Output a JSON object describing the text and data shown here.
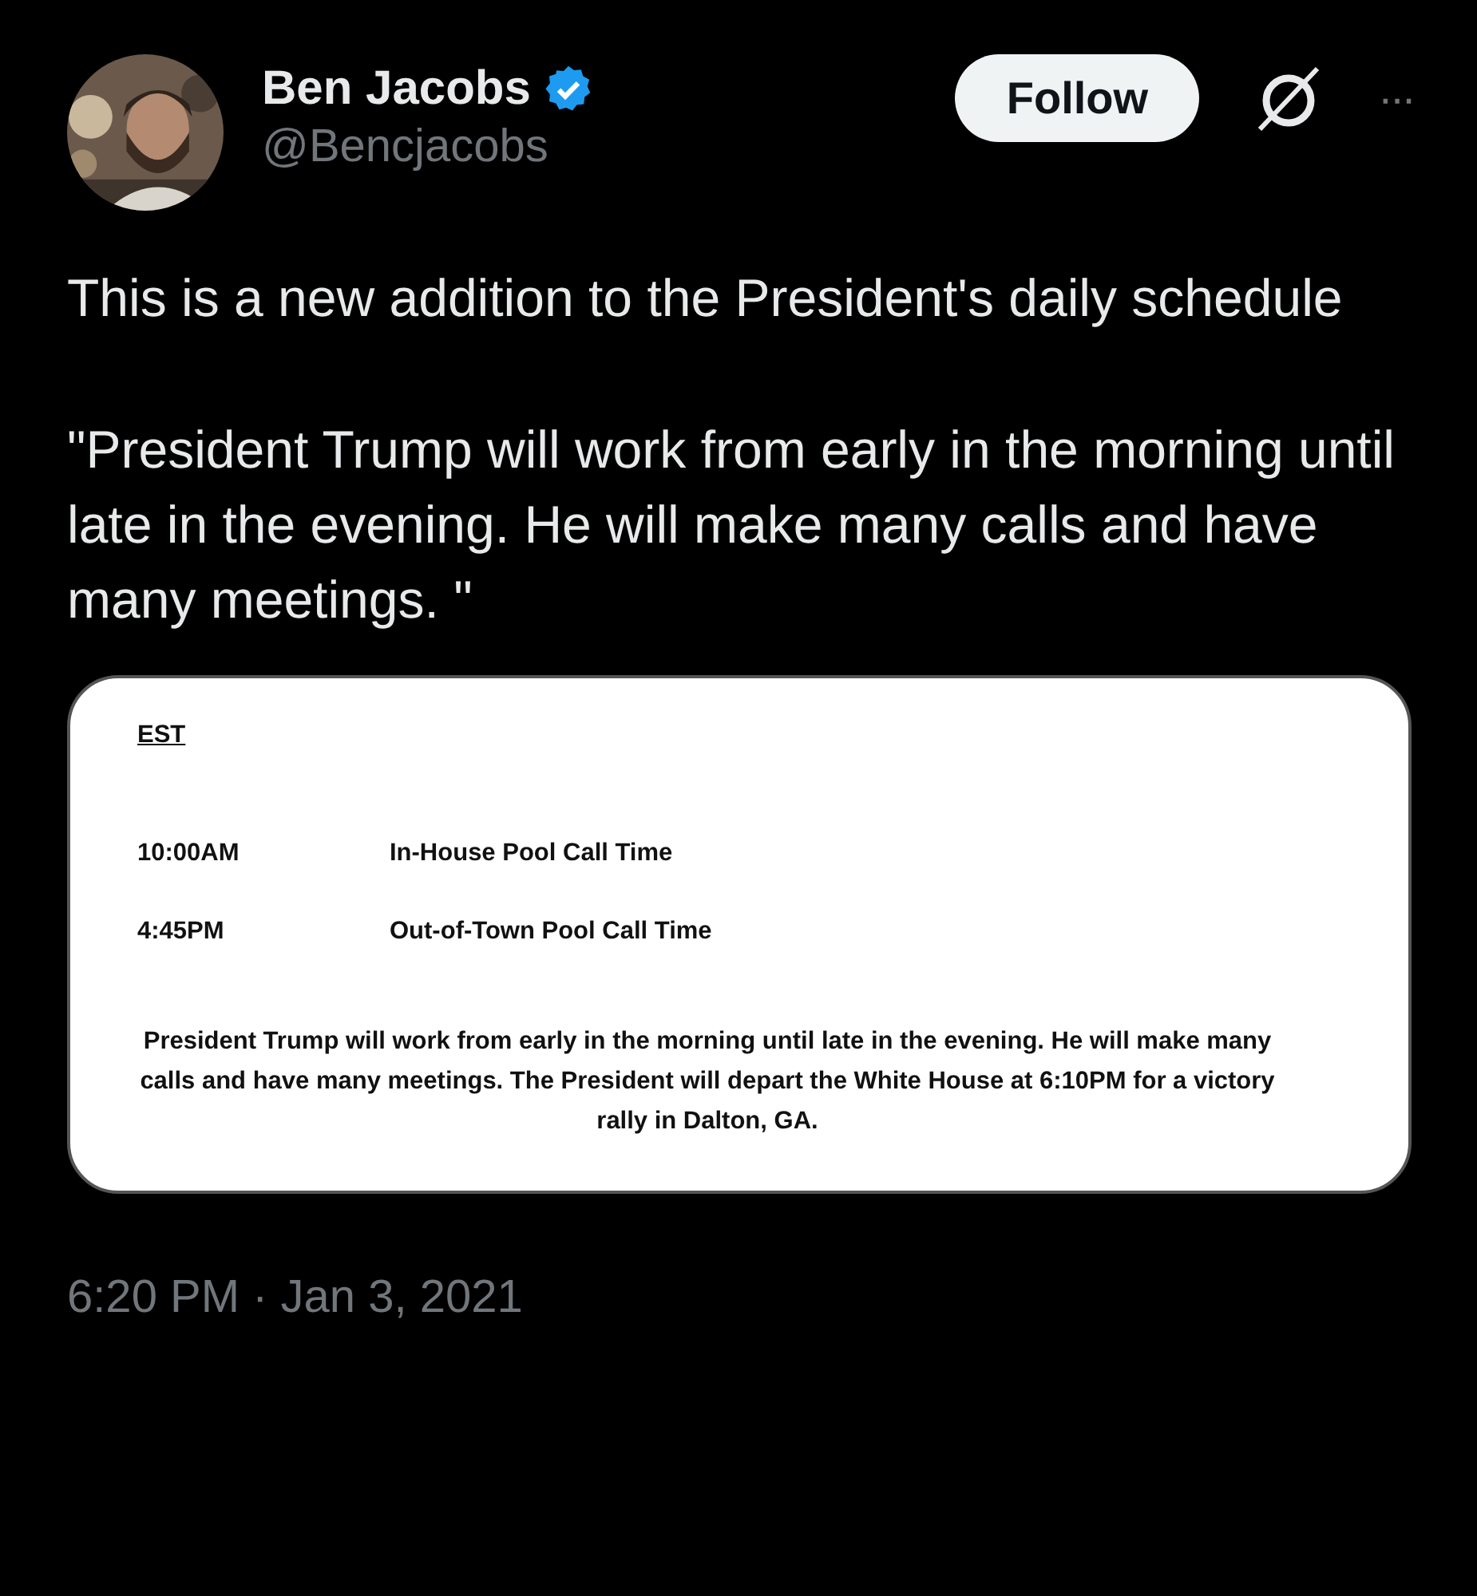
{
  "author": {
    "name": "Ben Jacobs",
    "verified": true,
    "handle": "@Bencjacobs"
  },
  "follow_button": {
    "label": "Follow"
  },
  "more_button": {
    "label": "···"
  },
  "text": [
    "This is a new addition to the President's daily schedule",
    "\"President Trump will work from early in the morning until late in the evening. He will make many calls and have many meetings. \""
  ],
  "attachment": {
    "heading": "EST",
    "rows": [
      {
        "time": "10:00AM",
        "event": "In-House Pool Call Time"
      },
      {
        "time": "4:45PM",
        "event": "Out-of-Town Pool Call Time"
      }
    ],
    "note": "President Trump will work from early in the morning until late in the evening. He will make many calls and have many meetings. The President will depart the White House at 6:10PM for a victory rally in Dalton, GA."
  },
  "timestamp": "6:20 PM · Jan 3, 2021"
}
